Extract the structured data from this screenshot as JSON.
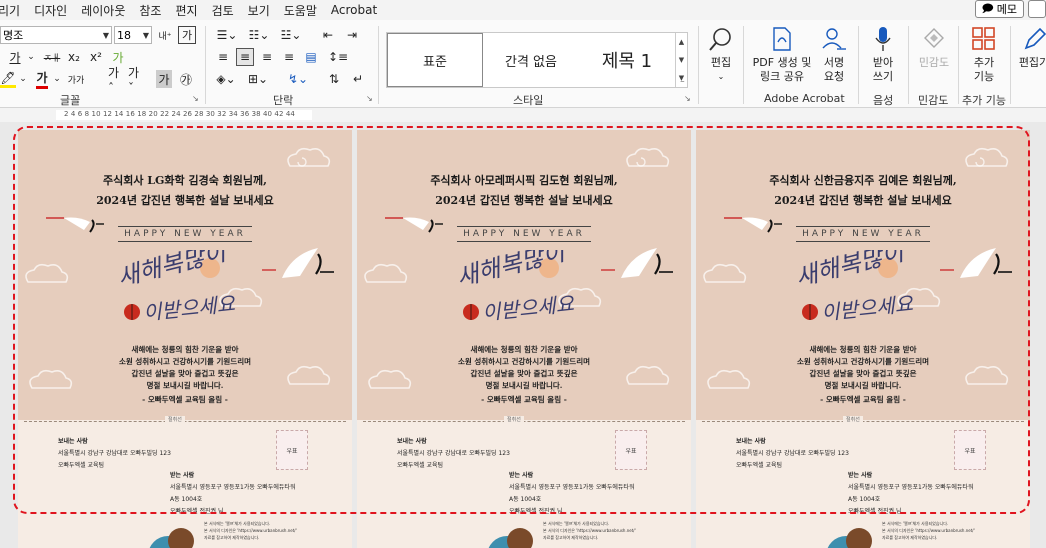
{
  "menu": {
    "items": [
      "리기",
      "디자인",
      "레이아웃",
      "참조",
      "편지",
      "검토",
      "보기",
      "도움말",
      "Acrobat"
    ],
    "memo_label": "메모"
  },
  "ribbon": {
    "font_name": "명조",
    "font_size": "18",
    "font_group_label": "글꼴",
    "paragraph_group_label": "단락",
    "style_group_label": "스타일",
    "styles": [
      "표준",
      "간격 없음",
      "제목 1"
    ],
    "edit_label": "편집",
    "pdf_label_1": "PDF 생성 및",
    "pdf_label_2": "링크 공유",
    "sign_label_1": "서명",
    "sign_label_2": "요청",
    "adobe_group_label": "Adobe Acrobat",
    "dictate_label_1": "받아",
    "dictate_label_2": "쓰기",
    "voice_group_label": "음성",
    "sensitivity_label": "민감도",
    "sensitivity_group_label": "민감도",
    "addins_label_1": "추가",
    "addins_label_2": "기능",
    "addins_group_label": "추가 기능",
    "editor_label": "편집기",
    "font_buttons": [
      "가",
      "가",
      "가",
      "x₂",
      "x²",
      "가",
      "가",
      "가",
      "가",
      "가",
      "가",
      "가",
      "가"
    ],
    "accent_color": "#185abd"
  },
  "ruler": {
    "numbers": "2  4  6  8  10 12 14 16 18 20 22 24 26 28 30 32 34 36 38 40 42 44"
  },
  "cards": [
    {
      "title_line1": "주식회사 LG화학 김경숙 회원님께,",
      "title_line2": "2024년 갑진년 행복한 설날 보내세요"
    },
    {
      "title_line1": "주식회사 아모레퍼시픽 김도현 회원님께,",
      "title_line2": "2024년 갑진년 행복한 설날 보내세요"
    },
    {
      "title_line1": "주식회사 신한금융지주 김예은 회원님께,",
      "title_line2": "2024년 갑진년 행복한 설날 보내세요"
    }
  ],
  "card_common": {
    "hny": "HAPPY NEW YEAR",
    "calligraphy_line1": "새해복많이",
    "calligraphy_line2": "이받으세요",
    "body_lines": [
      "새해에는 청룡의 힘찬 기운을 받아",
      "소원 성취하시고 건강하시기를 기원드리며",
      "갑진년 설날을 맞아 즐겁고 뜻깊은",
      "명절 보내시길 바랍니다."
    ],
    "signature": "- 오빠두엑셀 교육팀 올림 -",
    "cut_label": "절취선",
    "sender_title": "보내는 사람",
    "sender_address": "서울특별시 강남구 강남대로 오빠두빌딩 123",
    "sender_name": "오빠두엑셀 교육팀",
    "stamp_label": "우표",
    "recipient_title": "받는 사람",
    "recipient_address": "서울특별시 영등포구 영등포1가동 오빠두에듀타워",
    "recipient_room": "A동 1004호",
    "recipient_name": "오빠두엑셀 전진권 님",
    "tail_lines": [
      "본 서식에는 '엘프'체가 사용되었습니다.",
      "본 서식의 디자인은 'https://www.urbanbrush.net/'",
      "자료를 참고하여 제작하였습니다."
    ],
    "colors": {
      "card_bg": "#e6cdbd",
      "card_bottom": "#f6ece4",
      "selection": "#e0141e",
      "lantern": "#c82b1e"
    }
  }
}
